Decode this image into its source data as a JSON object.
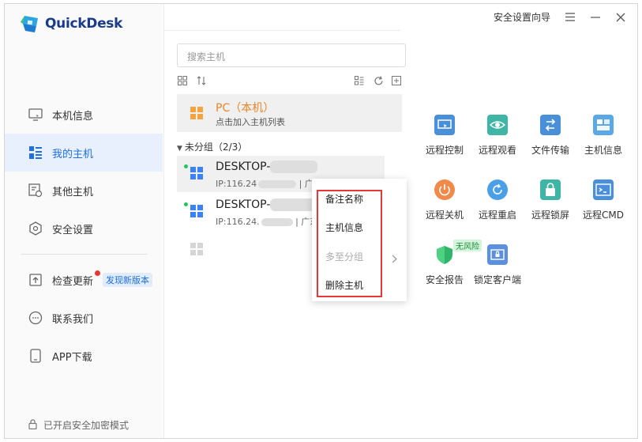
{
  "app": {
    "name": "QuickDesk"
  },
  "titlebar": {
    "security_wizard": "安全设置向导"
  },
  "sidebar": {
    "items": [
      {
        "label": "本机信息",
        "icon": "monitor-icon"
      },
      {
        "label": "我的主机",
        "icon": "host-list-icon"
      },
      {
        "label": "其他主机",
        "icon": "other-hosts-icon"
      },
      {
        "label": "安全设置",
        "icon": "shield-settings-icon"
      }
    ],
    "items2": [
      {
        "label": "检查更新",
        "icon": "update-icon",
        "badge": "发现新版本"
      },
      {
        "label": "联系我们",
        "icon": "chat-icon"
      },
      {
        "label": "APP下载",
        "icon": "phone-icon"
      }
    ],
    "footer": "已开启安全加密模式"
  },
  "middle": {
    "search_placeholder": "搜索主机",
    "local_pc": {
      "title": "PC（本机）",
      "subtitle": "点击加入主机列表"
    },
    "group": {
      "label": "未分组",
      "count": "（2/3）"
    },
    "hosts": [
      {
        "name": "DESKTOP-",
        "ip": "IP:116.24",
        "region": "| 广东"
      },
      {
        "name": "DESKTOP-",
        "ip": "IP:116.24.",
        "region": "| 广东"
      }
    ]
  },
  "context_menu": {
    "items": [
      {
        "label": "备注名称",
        "disabled": false
      },
      {
        "label": "主机信息",
        "disabled": false
      },
      {
        "label": "多至分组",
        "disabled": true
      },
      {
        "label": "删除主机",
        "disabled": false
      }
    ]
  },
  "functions": [
    {
      "label": "远程控制",
      "icon": "remote-control-icon",
      "color": "#4a90d9"
    },
    {
      "label": "远程观看",
      "icon": "remote-view-icon",
      "color": "#3fb5a6"
    },
    {
      "label": "文件传输",
      "icon": "file-transfer-icon",
      "color": "#4a90d9"
    },
    {
      "label": "主机信息",
      "icon": "host-info-icon",
      "color": "#5ba8e6"
    },
    {
      "label": "远程关机",
      "icon": "remote-shutdown-icon",
      "color": "#f08a4b"
    },
    {
      "label": "远程重启",
      "icon": "remote-restart-icon",
      "color": "#4a9fe6"
    },
    {
      "label": "远程锁屏",
      "icon": "remote-lock-icon",
      "color": "#3fb5a6"
    },
    {
      "label": "远程CMD",
      "icon": "remote-cmd-icon",
      "color": "#4a90d9"
    },
    {
      "label": "安全报告",
      "icon": "security-report-icon",
      "color": "#2fb56a",
      "tag": "无风险"
    },
    {
      "label": "锁定客户端",
      "icon": "lock-client-icon",
      "color": "#5b8fe0"
    }
  ]
}
